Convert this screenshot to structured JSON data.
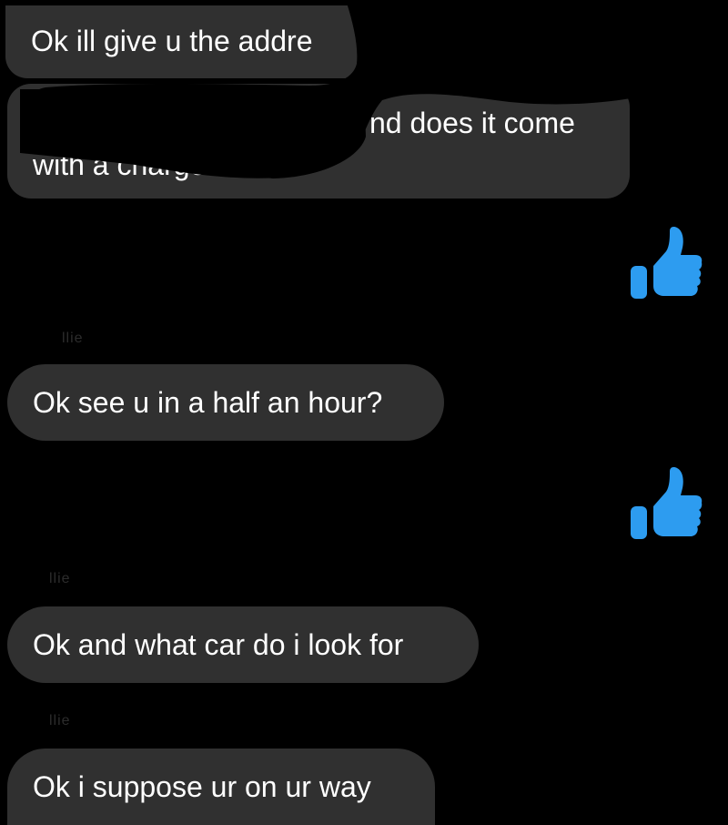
{
  "messages": [
    {
      "text": "Ok ill give u the addre"
    },
    {
      "line1": "nd does it come",
      "line2": "with a charge."
    },
    {
      "text": "Ok see u in a half an hour?"
    },
    {
      "text": "Ok and what car do i look for"
    },
    {
      "text": "Ok i suppose ur on ur way"
    }
  ],
  "reactions": [
    {
      "icon": "thumbs-up-icon",
      "color": "#2d9cf0"
    },
    {
      "icon": "thumbs-up-icon",
      "color": "#2d9cf0"
    }
  ],
  "sender_labels": [
    "llie",
    "llie",
    "llie"
  ],
  "theme": {
    "background": "#000000",
    "bubble": "#303030",
    "text": "#ffffff",
    "accent": "#2d9cf0"
  }
}
